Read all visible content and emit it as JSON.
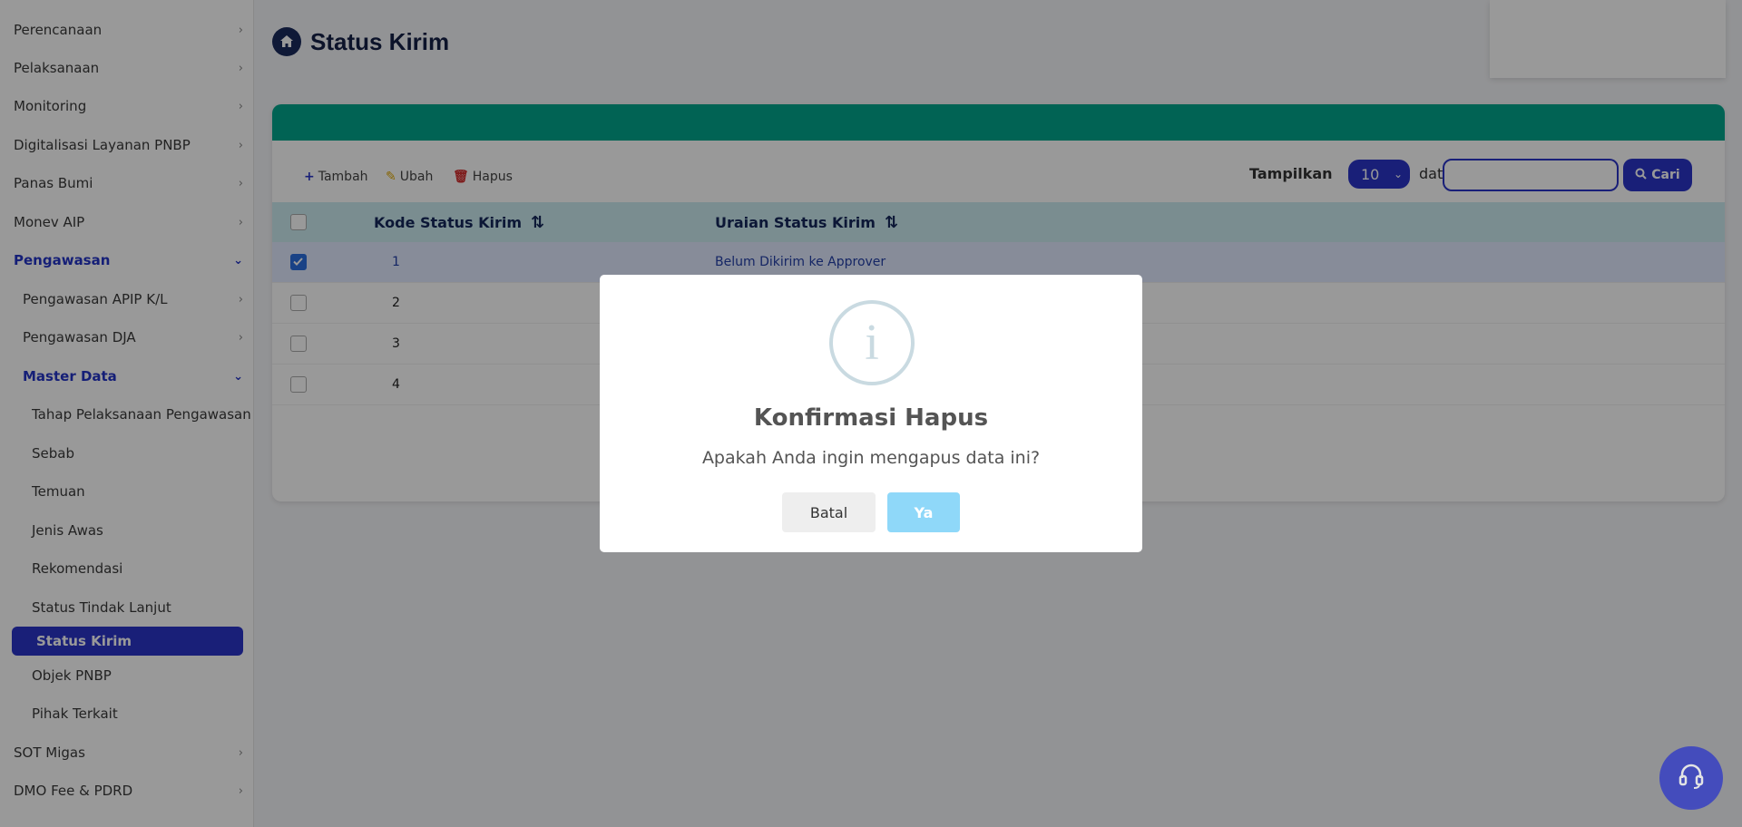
{
  "sidebar": {
    "items": [
      {
        "label": "Perencanaan",
        "chev": "›"
      },
      {
        "label": "Pelaksanaan",
        "chev": "›"
      },
      {
        "label": "Monitoring",
        "chev": "›"
      },
      {
        "label": "Digitalisasi Layanan PNBP",
        "chev": "›"
      },
      {
        "label": "Panas Bumi",
        "chev": "›"
      },
      {
        "label": "Monev AIP",
        "chev": "›"
      },
      {
        "label": "Pengawasan",
        "chev": "⌄"
      },
      {
        "label": "Pengawasan APIP K/L",
        "chev": "›"
      },
      {
        "label": "Pengawasan DJA",
        "chev": "›"
      },
      {
        "label": "Master Data",
        "chev": "⌄"
      },
      {
        "label": "Tahap Pelaksanaan Pengawasan"
      },
      {
        "label": "Sebab"
      },
      {
        "label": "Temuan"
      },
      {
        "label": "Jenis Awas"
      },
      {
        "label": "Rekomendasi"
      },
      {
        "label": "Status Tindak Lanjut"
      },
      {
        "label": "Status Kirim"
      },
      {
        "label": "Objek PNBP"
      },
      {
        "label": "Pihak Terkait"
      },
      {
        "label": "SOT Migas",
        "chev": "›"
      },
      {
        "label": "DMO Fee & PDRD",
        "chev": "›"
      }
    ]
  },
  "page": {
    "title": "Status Kirim"
  },
  "toolbar": {
    "add_label": "Tambah",
    "edit_label": "Ubah",
    "delete_label": "Hapus",
    "show_label": "Tampilkan",
    "page_size": "10",
    "data_label": "data",
    "search_placeholder": "",
    "search_label": "Cari"
  },
  "table": {
    "headers": [
      "Kode Status Kirim",
      "Uraian Status Kirim"
    ],
    "rows": [
      {
        "kode": "1",
        "uraian": "Belum Dikirim ke Approver",
        "checked": true
      },
      {
        "kode": "2",
        "uraian": "",
        "checked": false
      },
      {
        "kode": "3",
        "uraian": "",
        "checked": false
      },
      {
        "kode": "4",
        "uraian": "",
        "checked": false
      }
    ]
  },
  "modal": {
    "title": "Konfirmasi Hapus",
    "message": "Apakah Anda ingin mengapus data ini?",
    "cancel_label": "Batal",
    "confirm_label": "Ya",
    "icon": "info-icon"
  },
  "colors": {
    "primary": "#2b35c9",
    "header_teal": "#02a58c",
    "table_head": "#cbecf0",
    "confirm_button": "#8fd8f9"
  }
}
